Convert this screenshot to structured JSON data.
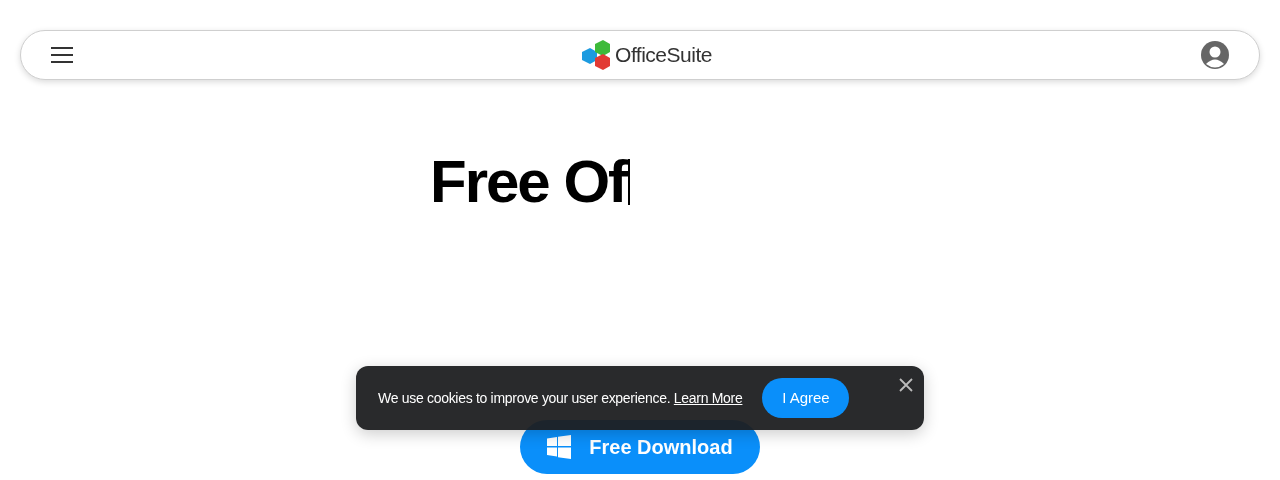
{
  "header": {
    "logo_text": "OfficeSuite"
  },
  "hero": {
    "heading": "Free Of"
  },
  "download_button": {
    "label": "Free Download"
  },
  "cookie_banner": {
    "message": "We use cookies to improve your user experience.",
    "link": "Learn More",
    "agree_button": "I Agree"
  }
}
